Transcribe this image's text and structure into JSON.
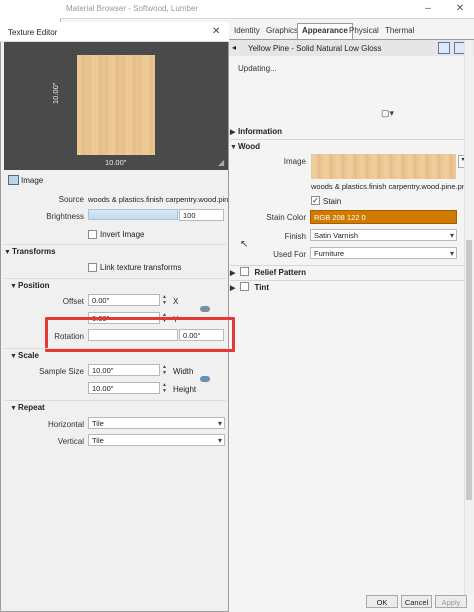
{
  "material_browser": {
    "title": "Material Browser - Softwood, Lumber",
    "tabs": [
      "Identity",
      "Graphics",
      "Appearance",
      "Physical",
      "Thermal"
    ],
    "active_tab": "Appearance",
    "asset_name": "Yellow Pine - Solid Natural Low Gloss",
    "updating_label": "Updating...",
    "sections": {
      "information": "Information",
      "wood": "Wood",
      "relief_pattern": "Relief Pattern",
      "tint": "Tint"
    },
    "wood": {
      "image_label": "Image",
      "image_path": "woods & plastics.finish carpentry.wood.pine.pn",
      "stain_label": "Stain",
      "stain_checked": true,
      "stain_color_label": "Stain Color",
      "stain_color_value": "RGB 208 122 0",
      "stain_color_hex": "#d07a00",
      "finish_label": "Finish",
      "finish_value": "Satin Varnish",
      "used_for_label": "Used For",
      "used_for_value": "Furniture"
    },
    "buttons": {
      "ok": "OK",
      "cancel": "Cancel",
      "apply": "Apply"
    }
  },
  "texture_editor": {
    "title": "Texture Editor",
    "preview_height_label": "10.00\"",
    "preview_width_label": "10.00\"",
    "image_section": "Image",
    "source_label": "Source",
    "source_value": "woods & plastics.finish carpentry.wood.pine.",
    "brightness_label": "Brightness",
    "brightness_value": "100",
    "invert_label": "Invert Image",
    "transforms_section": "Transforms",
    "link_label": "Link texture transforms",
    "position_section": "Position",
    "offset_label": "Offset",
    "offset_x_value": "0.00\"",
    "offset_x_axis": "X",
    "offset_y_value": "0.00\"",
    "offset_y_axis": "Y",
    "rotation_label": "Rotation",
    "rotation_value": "0.00°",
    "scale_section": "Scale",
    "sample_size_label": "Sample Size",
    "width_value": "10.00\"",
    "width_label": "Width",
    "height_value": "10.00\"",
    "height_label": "Height",
    "repeat_section": "Repeat",
    "horizontal_label": "Horizontal",
    "horizontal_value": "Tile",
    "vertical_label": "Vertical",
    "vertical_value": "Tile"
  },
  "colors": {
    "highlight": "#e53935",
    "stain": "#d07a00"
  }
}
